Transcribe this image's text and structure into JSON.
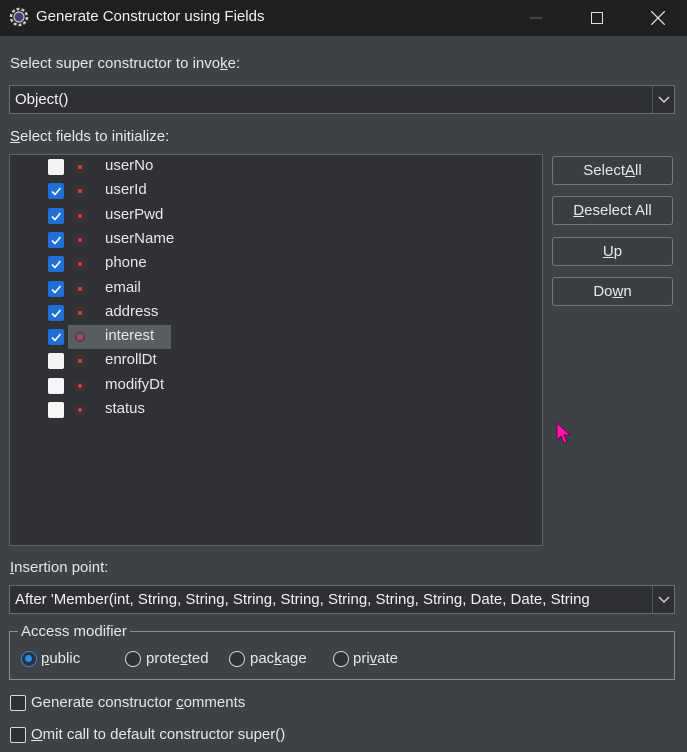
{
  "window": {
    "title": "Generate Constructor using Fields"
  },
  "super_constructor": {
    "label_pre": "Select super constructor to invo",
    "label_mn": "k",
    "label_post": "e:",
    "value": "Object()"
  },
  "fields_section": {
    "label_mn": "S",
    "label_post": "elect fields to initialize:",
    "fields": [
      {
        "name": "userNo",
        "checked": false
      },
      {
        "name": "userId",
        "checked": true
      },
      {
        "name": "userPwd",
        "checked": true
      },
      {
        "name": "userName",
        "checked": true
      },
      {
        "name": "phone",
        "checked": true
      },
      {
        "name": "email",
        "checked": true
      },
      {
        "name": "address",
        "checked": true
      },
      {
        "name": "interest",
        "checked": true
      },
      {
        "name": "enrollDt",
        "checked": false
      },
      {
        "name": "modifyDt",
        "checked": false
      },
      {
        "name": "status",
        "checked": false
      }
    ],
    "selected_field": "interest"
  },
  "side_buttons": {
    "select_all_pre": "Select ",
    "select_all_mn": "A",
    "select_all_post": "ll",
    "deselect_all_mn": "D",
    "deselect_all_post": "eselect All",
    "up_mn": "U",
    "up_post": "p",
    "down_pre": "Do",
    "down_mn": "w",
    "down_post": "n"
  },
  "insertion": {
    "label_mn": "I",
    "label_post": "nsertion point:",
    "value": "After 'Member(int, String, String, String, String, String, String, String, Date, Date, String"
  },
  "access_modifier": {
    "legend": "Access modifier",
    "options": [
      {
        "mn": "p",
        "rest": "ublic",
        "selected": true
      },
      {
        "pre": "prote",
        "mn": "c",
        "rest": "ted",
        "selected": false
      },
      {
        "pre": "pac",
        "mn": "k",
        "rest": "age",
        "selected": false
      },
      {
        "pre": "pri",
        "mn": "v",
        "rest": "ate",
        "selected": false
      }
    ]
  },
  "options": {
    "comments_pre": "Generate constructor ",
    "comments_mn": "c",
    "comments_post": "omments",
    "comments_checked": false,
    "omit_mn": "O",
    "omit_post": "mit call to default constructor super()",
    "omit_checked": false
  }
}
